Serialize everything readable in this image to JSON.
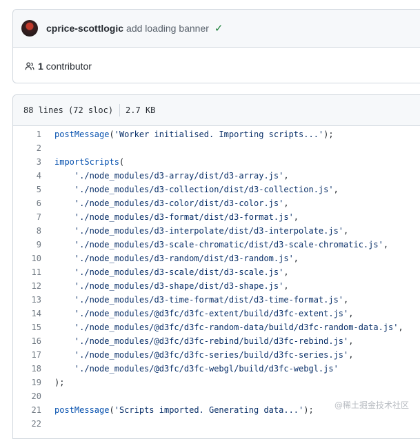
{
  "commit": {
    "author": "cprice-scottlogic",
    "message": "add loading banner",
    "status_icon": "check-icon"
  },
  "contributors": {
    "count": "1",
    "label": "contributor"
  },
  "file": {
    "lines_info": "88 lines (72 sloc)",
    "size": "2.7 KB"
  },
  "code_lines": [
    {
      "n": "1",
      "parts": [
        {
          "t": "fn",
          "v": "postMessage"
        },
        {
          "t": "p",
          "v": "("
        },
        {
          "t": "str",
          "v": "'Worker initialised. Importing scripts...'"
        },
        {
          "t": "p",
          "v": ");"
        }
      ]
    },
    {
      "n": "2",
      "parts": []
    },
    {
      "n": "3",
      "parts": [
        {
          "t": "fn",
          "v": "importScripts"
        },
        {
          "t": "p",
          "v": "("
        }
      ]
    },
    {
      "n": "4",
      "parts": [
        {
          "t": "p",
          "v": "    "
        },
        {
          "t": "str",
          "v": "'./node_modules/d3-array/dist/d3-array.js'"
        },
        {
          "t": "p",
          "v": ","
        }
      ]
    },
    {
      "n": "5",
      "parts": [
        {
          "t": "p",
          "v": "    "
        },
        {
          "t": "str",
          "v": "'./node_modules/d3-collection/dist/d3-collection.js'"
        },
        {
          "t": "p",
          "v": ","
        }
      ]
    },
    {
      "n": "6",
      "parts": [
        {
          "t": "p",
          "v": "    "
        },
        {
          "t": "str",
          "v": "'./node_modules/d3-color/dist/d3-color.js'"
        },
        {
          "t": "p",
          "v": ","
        }
      ]
    },
    {
      "n": "7",
      "parts": [
        {
          "t": "p",
          "v": "    "
        },
        {
          "t": "str",
          "v": "'./node_modules/d3-format/dist/d3-format.js'"
        },
        {
          "t": "p",
          "v": ","
        }
      ]
    },
    {
      "n": "8",
      "parts": [
        {
          "t": "p",
          "v": "    "
        },
        {
          "t": "str",
          "v": "'./node_modules/d3-interpolate/dist/d3-interpolate.js'"
        },
        {
          "t": "p",
          "v": ","
        }
      ]
    },
    {
      "n": "9",
      "parts": [
        {
          "t": "p",
          "v": "    "
        },
        {
          "t": "str",
          "v": "'./node_modules/d3-scale-chromatic/dist/d3-scale-chromatic.js'"
        },
        {
          "t": "p",
          "v": ","
        }
      ]
    },
    {
      "n": "10",
      "parts": [
        {
          "t": "p",
          "v": "    "
        },
        {
          "t": "str",
          "v": "'./node_modules/d3-random/dist/d3-random.js'"
        },
        {
          "t": "p",
          "v": ","
        }
      ]
    },
    {
      "n": "11",
      "parts": [
        {
          "t": "p",
          "v": "    "
        },
        {
          "t": "str",
          "v": "'./node_modules/d3-scale/dist/d3-scale.js'"
        },
        {
          "t": "p",
          "v": ","
        }
      ]
    },
    {
      "n": "12",
      "parts": [
        {
          "t": "p",
          "v": "    "
        },
        {
          "t": "str",
          "v": "'./node_modules/d3-shape/dist/d3-shape.js'"
        },
        {
          "t": "p",
          "v": ","
        }
      ]
    },
    {
      "n": "13",
      "parts": [
        {
          "t": "p",
          "v": "    "
        },
        {
          "t": "str",
          "v": "'./node_modules/d3-time-format/dist/d3-time-format.js'"
        },
        {
          "t": "p",
          "v": ","
        }
      ]
    },
    {
      "n": "14",
      "parts": [
        {
          "t": "p",
          "v": "    "
        },
        {
          "t": "str",
          "v": "'./node_modules/@d3fc/d3fc-extent/build/d3fc-extent.js'"
        },
        {
          "t": "p",
          "v": ","
        }
      ]
    },
    {
      "n": "15",
      "parts": [
        {
          "t": "p",
          "v": "    "
        },
        {
          "t": "str",
          "v": "'./node_modules/@d3fc/d3fc-random-data/build/d3fc-random-data.js'"
        },
        {
          "t": "p",
          "v": ","
        }
      ]
    },
    {
      "n": "16",
      "parts": [
        {
          "t": "p",
          "v": "    "
        },
        {
          "t": "str",
          "v": "'./node_modules/@d3fc/d3fc-rebind/build/d3fc-rebind.js'"
        },
        {
          "t": "p",
          "v": ","
        }
      ]
    },
    {
      "n": "17",
      "parts": [
        {
          "t": "p",
          "v": "    "
        },
        {
          "t": "str",
          "v": "'./node_modules/@d3fc/d3fc-series/build/d3fc-series.js'"
        },
        {
          "t": "p",
          "v": ","
        }
      ]
    },
    {
      "n": "18",
      "parts": [
        {
          "t": "p",
          "v": "    "
        },
        {
          "t": "str",
          "v": "'./node_modules/@d3fc/d3fc-webgl/build/d3fc-webgl.js'"
        }
      ]
    },
    {
      "n": "19",
      "parts": [
        {
          "t": "p",
          "v": ");"
        }
      ]
    },
    {
      "n": "20",
      "parts": []
    },
    {
      "n": "21",
      "parts": [
        {
          "t": "fn",
          "v": "postMessage"
        },
        {
          "t": "p",
          "v": "("
        },
        {
          "t": "str",
          "v": "'Scripts imported. Generating data...'"
        },
        {
          "t": "p",
          "v": ");"
        }
      ]
    },
    {
      "n": "22",
      "parts": []
    }
  ],
  "watermark": "@稀土掘金技术社区",
  "colors": {
    "function": "#0550ae",
    "string": "#0a3069",
    "check": "#1a7f37",
    "border": "#d0d7de"
  }
}
